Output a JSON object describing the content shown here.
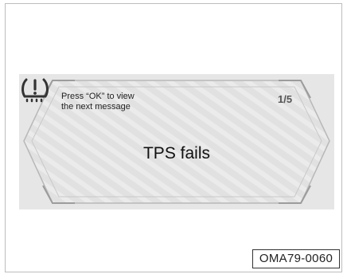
{
  "display": {
    "hint_text": "Press “OK” to view\nthe next message",
    "page_indicator": "1/5",
    "warning_icon": "tpms-warning-icon",
    "message": "TPS fails"
  },
  "figure_code": "OMA79-0060"
}
